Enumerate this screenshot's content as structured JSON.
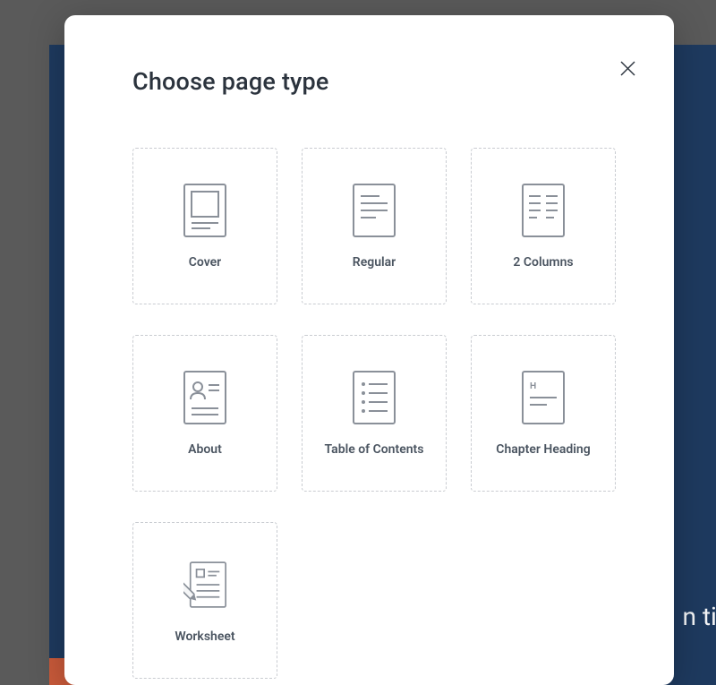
{
  "modal": {
    "title": "Choose page type",
    "options": [
      {
        "id": "cover",
        "label": "Cover"
      },
      {
        "id": "regular",
        "label": "Regular"
      },
      {
        "id": "two-columns",
        "label": "2 Columns"
      },
      {
        "id": "about",
        "label": "About"
      },
      {
        "id": "table-of-contents",
        "label": "Table of Contents"
      },
      {
        "id": "chapter-heading",
        "label": "Chapter Heading"
      },
      {
        "id": "worksheet",
        "label": "Worksheet"
      }
    ]
  },
  "background": {
    "peek_text": "n tit"
  }
}
